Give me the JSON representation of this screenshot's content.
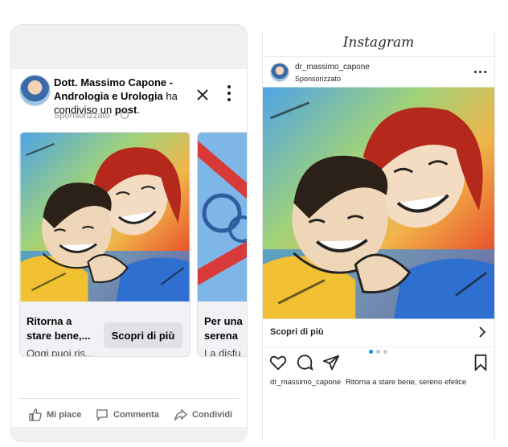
{
  "facebook": {
    "page_name": "Dott. Massimo Capone - Andrologia e Urologia",
    "action_text": "ha condiviso un",
    "post_word": "post",
    "post_suffix": ".",
    "sponsored": "Sponsorizzato",
    "cards": [
      {
        "headline_1": "Ritorna a",
        "headline_2": "stare bene,...",
        "sub": "Oggi puoi ris...",
        "cta": "Scopri di più"
      },
      {
        "headline_1": "Per una",
        "headline_2": "serena",
        "sub": "La disfu"
      }
    ],
    "actions": {
      "like": "Mi piace",
      "comment": "Commenta",
      "share": "Condividi"
    }
  },
  "instagram": {
    "logo": "Instagram",
    "username": "dr_massimo_capone",
    "sponsored": "Sponsorizzato",
    "cta": "Scopri di più",
    "carousel": {
      "total": 3,
      "active": 1
    },
    "caption_user": "dr_massimo_capone",
    "caption_text": "Ritorna a stare bene, sereno efelice"
  },
  "colors": {
    "ig_active_dot": "#0095f6",
    "fb_button": "#dfe1e5",
    "fb_muted": "#65676b"
  }
}
